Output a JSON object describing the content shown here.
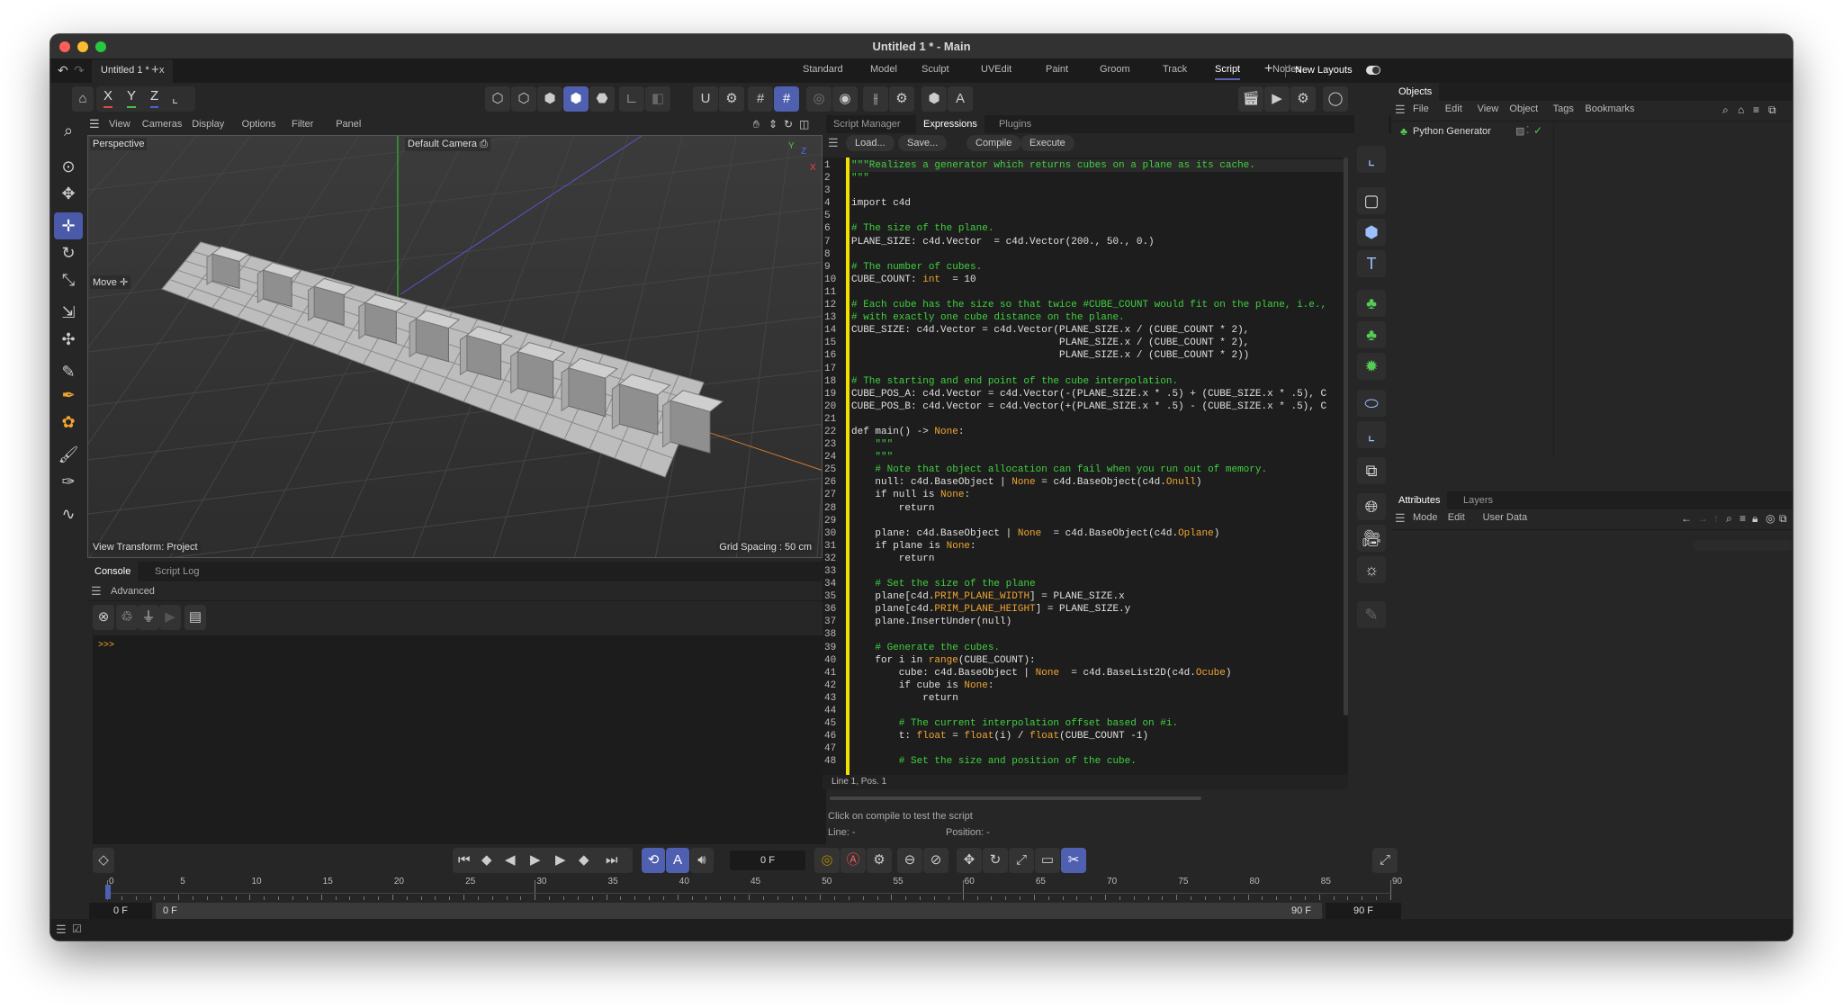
{
  "window": {
    "title": "Untitled 1 * - Main"
  },
  "tabs": {
    "document_tab": "Untitled 1 *",
    "close": "x",
    "add": "+"
  },
  "layouts": {
    "items": [
      "Standard",
      "Model",
      "Sculpt",
      "UVEdit",
      "Paint",
      "Groom",
      "Track",
      "Script",
      "Nodes"
    ],
    "active": "Script",
    "add": "+",
    "new_layouts_label": "New Layouts",
    "accent": "#5a62b0"
  },
  "toolbar": {
    "x": "X",
    "y": "Y",
    "z": "Z"
  },
  "viewport": {
    "menu": [
      "View",
      "Cameras",
      "Display",
      "Options",
      "Filter",
      "Panel"
    ],
    "projection": "Perspective",
    "camera": "Default Camera",
    "tool": "Move",
    "view_transform": "View Transform: Project",
    "grid_spacing": "Grid Spacing : 50 cm",
    "axis_labels": {
      "x": "X",
      "y": "Y",
      "z": "Z"
    }
  },
  "console": {
    "tabs": [
      "Console",
      "Script Log"
    ],
    "active_tab": "Console",
    "mode": "Advanced",
    "prompt": ">>>"
  },
  "script_manager": {
    "tabs": [
      "Script Manager",
      "Expressions",
      "Plugins"
    ],
    "active_tab": "Expressions",
    "buttons": [
      "Load...",
      "Save...",
      "Compile",
      "Execute"
    ],
    "cursor_status": "Line 1, Pos. 1",
    "message": "Click on compile to test the script",
    "line_label": "Line: -",
    "position_label": "Position: -",
    "code": [
      [
        [
          "\"\"\"Realizes a generator which returns cubes on a plane as its cache.",
          "c"
        ]
      ],
      [
        [
          "\"\"\"",
          "c"
        ]
      ],
      [],
      [
        [
          "import c4d",
          ""
        ]
      ],
      [],
      [
        [
          "# The size of the plane.",
          "c"
        ]
      ],
      [
        [
          "PLANE_SIZE: c4d.Vector  = c4d.Vector(200., 50., 0.)",
          ""
        ]
      ],
      [],
      [
        [
          "# The number of cubes.",
          "c"
        ]
      ],
      [
        [
          "CUBE_COUNT: ",
          ""
        ],
        [
          "int",
          "k"
        ],
        [
          "  = 10",
          ""
        ]
      ],
      [],
      [
        [
          "# Each cube has the size so that twice #CUBE_COUNT would fit on the plane, i.e.,",
          "c"
        ]
      ],
      [
        [
          "# with exactly one cube distance on the plane.",
          "c"
        ]
      ],
      [
        [
          "CUBE_SIZE: c4d.Vector = c4d.Vector(PLANE_SIZE.x / (CUBE_COUNT * 2),",
          ""
        ]
      ],
      [
        [
          "                                   PLANE_SIZE.x / (CUBE_COUNT * 2),",
          ""
        ]
      ],
      [
        [
          "                                   PLANE_SIZE.x / (CUBE_COUNT * 2))",
          ""
        ]
      ],
      [],
      [
        [
          "# The starting and end point of the cube interpolation.",
          "c"
        ]
      ],
      [
        [
          "CUBE_POS_A: c4d.Vector = c4d.Vector(-(PLANE_SIZE.x * .5) + (CUBE_SIZE.x * .5), C",
          ""
        ]
      ],
      [
        [
          "CUBE_POS_B: c4d.Vector = c4d.Vector(+(PLANE_SIZE.x * .5) - (CUBE_SIZE.x * .5), C",
          ""
        ]
      ],
      [],
      [
        [
          "def main() -> ",
          ""
        ],
        [
          "None",
          "k"
        ],
        [
          ":",
          ""
        ]
      ],
      [
        [
          "    \"\"\"",
          "c"
        ]
      ],
      [
        [
          "    \"\"\"",
          "c"
        ]
      ],
      [
        [
          "    # Note that object allocation can fail when you run out of memory.",
          "c"
        ]
      ],
      [
        [
          "    null: c4d.BaseObject | ",
          ""
        ],
        [
          "None",
          "k"
        ],
        [
          " = c4d.BaseObject(c4d.",
          ""
        ],
        [
          "Onull",
          "k"
        ],
        [
          ")",
          ""
        ]
      ],
      [
        [
          "    if null is ",
          ""
        ],
        [
          "None",
          "k"
        ],
        [
          ":",
          ""
        ]
      ],
      [
        [
          "        return",
          ""
        ]
      ],
      [],
      [
        [
          "    plane: c4d.BaseObject | ",
          ""
        ],
        [
          "None",
          "k"
        ],
        [
          "  = c4d.BaseObject(c4d.",
          ""
        ],
        [
          "Oplane",
          "k"
        ],
        [
          ")",
          ""
        ]
      ],
      [
        [
          "    if plane is ",
          ""
        ],
        [
          "None",
          "k"
        ],
        [
          ":",
          ""
        ]
      ],
      [
        [
          "        return",
          ""
        ]
      ],
      [],
      [
        [
          "    # Set the size of the plane",
          "c"
        ]
      ],
      [
        [
          "    plane[c4d.",
          ""
        ],
        [
          "PRIM_PLANE_WIDTH",
          "k"
        ],
        [
          "] = PLANE_SIZE.x",
          ""
        ]
      ],
      [
        [
          "    plane[c4d.",
          ""
        ],
        [
          "PRIM_PLANE_HEIGHT",
          "k"
        ],
        [
          "] = PLANE_SIZE.y",
          ""
        ]
      ],
      [
        [
          "    plane.InsertUnder(null)",
          ""
        ]
      ],
      [],
      [
        [
          "    # Generate the cubes.",
          "c"
        ]
      ],
      [
        [
          "    for i in ",
          ""
        ],
        [
          "range",
          "k"
        ],
        [
          "(CUBE_COUNT):",
          ""
        ]
      ],
      [
        [
          "        cube: c4d.BaseObject | ",
          ""
        ],
        [
          "None",
          "k"
        ],
        [
          "  = c4d.BaseList2D(c4d.",
          ""
        ],
        [
          "Ocube",
          "k"
        ],
        [
          ")",
          ""
        ]
      ],
      [
        [
          "        if cube is ",
          ""
        ],
        [
          "None",
          "k"
        ],
        [
          ":",
          ""
        ]
      ],
      [
        [
          "            return",
          ""
        ]
      ],
      [],
      [
        [
          "        # The current interpolation offset based on #i.",
          "c"
        ]
      ],
      [
        [
          "        t: ",
          ""
        ],
        [
          "float",
          "k"
        ],
        [
          " = ",
          ""
        ],
        [
          "float",
          "k"
        ],
        [
          "(i) / ",
          ""
        ],
        [
          "float",
          "k"
        ],
        [
          "(CUBE_COUNT -1)",
          ""
        ]
      ],
      [],
      [
        [
          "        # Set the size and position of the cube.",
          "c"
        ]
      ]
    ],
    "colors": {
      "comment": "#3fd13f",
      "keyword": "#f0a530",
      "gutter_marker": "#f4e000"
    }
  },
  "objects_panel": {
    "title": "Objects",
    "menu": [
      "File",
      "Edit",
      "View",
      "Object",
      "Tags",
      "Bookmarks"
    ],
    "items": [
      {
        "name": "Python Generator",
        "enabled": true
      }
    ]
  },
  "attributes_panel": {
    "tabs": [
      "Attributes",
      "Layers"
    ],
    "active_tab": "Attributes",
    "menu": [
      "Mode",
      "Edit",
      "User Data"
    ]
  },
  "timeline": {
    "current_frame": "0 F",
    "ticks": [
      "0",
      "5",
      "10",
      "15",
      "20",
      "25",
      "30",
      "35",
      "40",
      "45",
      "50",
      "55",
      "60",
      "65",
      "70",
      "75",
      "80",
      "85",
      "90"
    ],
    "range_start": "0 F",
    "range_inner_start": "0 F",
    "range_inner_end": "90 F",
    "range_end": "90 F"
  }
}
